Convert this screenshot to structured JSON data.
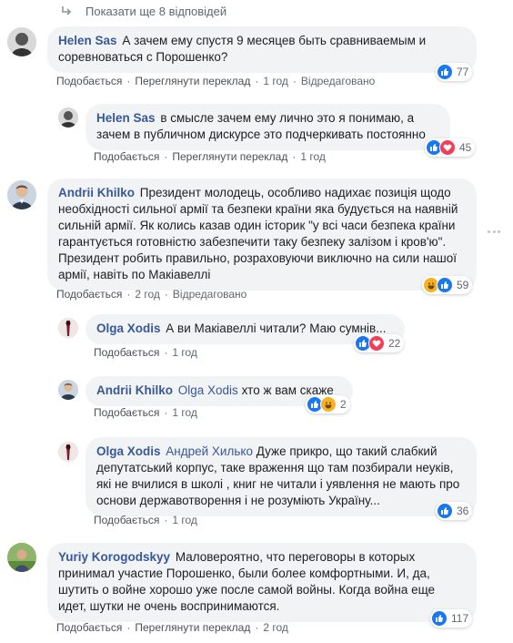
{
  "more_replies": {
    "label": "Показати ще 8 відповідей"
  },
  "comments": [
    {
      "author": "Helen Sas",
      "text": "А зачем ему спустя 9 месяцев быть сравниваемым и соревноваться с Порошенко?",
      "actions": {
        "like": "Подобається",
        "translate": "Переглянути переклад",
        "time": "1 год",
        "edited": "Відредаговано"
      },
      "reactions": {
        "count": "77",
        "types": [
          "like"
        ]
      }
    },
    {
      "author": "Helen Sas",
      "text": "в смысле зачем ему лично это я понимаю, а зачем в публичном дискурсе это подчеркивать постоянно",
      "actions": {
        "like": "Подобається",
        "translate": "Переглянути переклад",
        "time": "1 год"
      },
      "reactions": {
        "count": "45",
        "types": [
          "like",
          "love"
        ]
      }
    },
    {
      "author": "Andrii Khilko",
      "text": "Президент молодець, особливо надихає позиція щодо необхідності сильної армії та безпеки країни яка будується на наявній сильній армії. Як колись казав один історик \"у всі часи безпека країни гарантується готовністю забезпечити таку безпеку залізом і кров'ю\". Президент робить правильно, розраховуючи виключно на сили нашої армії, навіть по Макіавеллі",
      "actions": {
        "like": "Подобається",
        "time": "2 год",
        "edited": "Відредаговано"
      },
      "reactions": {
        "count": "59",
        "types": [
          "haha",
          "like"
        ]
      }
    },
    {
      "author": "Olga Xodis",
      "text": "А ви Макіавеллі читали? Маю сумнів...",
      "actions": {
        "like": "Подобається",
        "time": "1 год"
      },
      "reactions": {
        "count": "22",
        "types": [
          "like",
          "love"
        ]
      }
    },
    {
      "author": "Andrii Khilko",
      "mention": "Olga Xodis",
      "text": "хто ж вам скаже",
      "actions": {
        "like": "Подобається",
        "time": "1 год"
      },
      "reactions": {
        "count": "2",
        "types": [
          "like",
          "haha"
        ]
      }
    },
    {
      "author": "Olga Xodis",
      "mention": "Андрей Хилько",
      "text": "Дуже прикро, що такий слабкий депутатський корпус, таке враження що там позбирали неуків, які не вчилися в школі , книг не читали і уявлення не мають про основи державотворення і не розуміють Україну...",
      "actions": {
        "like": "Подобається",
        "time": "1 год"
      },
      "reactions": {
        "count": "36",
        "types": [
          "like"
        ]
      }
    },
    {
      "author": "Yuriy Korogodskyy",
      "text": "Маловероятно, что переговоры в которых принимал участие Порошенко, были более комфортными. И, да, шутить о войне хорошо уже после самой войны. Когда война еще идет, шутки не очень воспринимаются.",
      "actions": {
        "like": "Подобається",
        "translate": "Переглянути переклад",
        "time": "2 год"
      },
      "reactions": {
        "count": "117",
        "types": [
          "like"
        ]
      }
    }
  ],
  "colors": {
    "link": "#385898",
    "bubble": "#f2f3f5",
    "like": "#1877f2",
    "love": "#f33e58",
    "haha": "#f7b125"
  }
}
